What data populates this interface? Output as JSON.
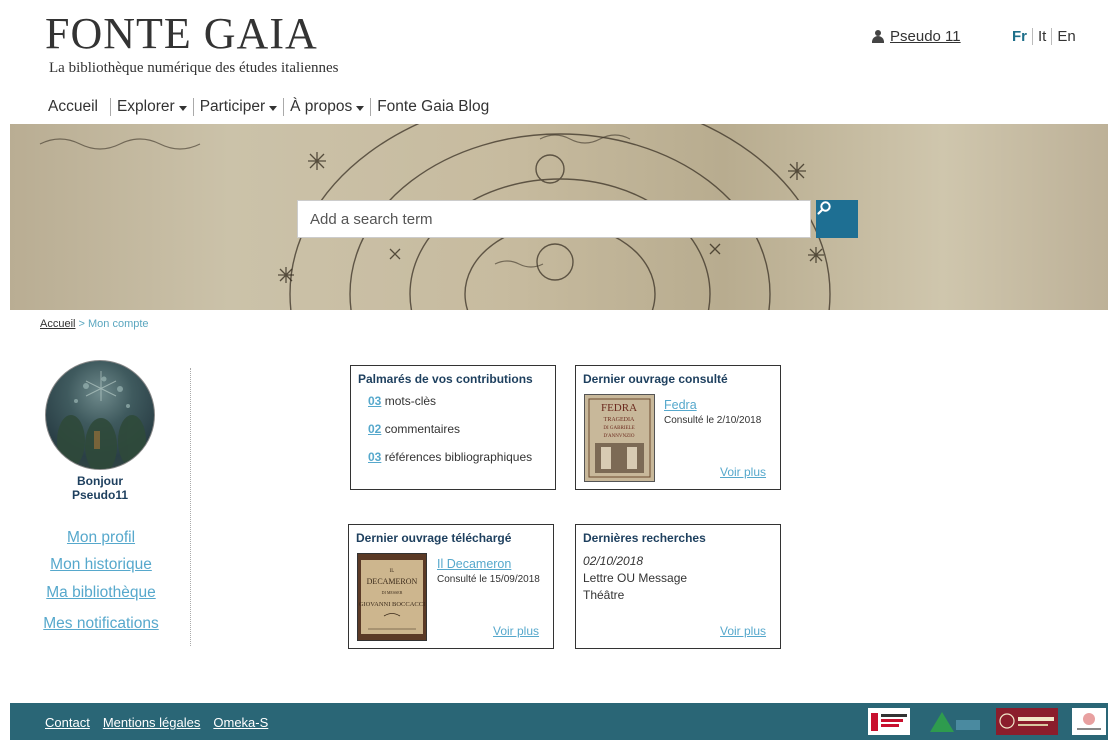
{
  "header": {
    "logo_title": "FONTE GAIA",
    "logo_subtitle": "La bibliothèque numérique des études italiennes",
    "user_name": "Pseudo 11",
    "languages": [
      "Fr",
      "It",
      "En"
    ]
  },
  "nav": {
    "items": [
      {
        "label": "Accueil",
        "dropdown": false
      },
      {
        "label": "Explorer",
        "dropdown": true
      },
      {
        "label": "Participer",
        "dropdown": true
      },
      {
        "label": "À propos",
        "dropdown": true
      },
      {
        "label": "Fonte Gaia Blog",
        "dropdown": false
      }
    ]
  },
  "search": {
    "placeholder": "Add a search term"
  },
  "breadcrumb": {
    "home": "Accueil",
    "separator": " > ",
    "current": "Mon compte"
  },
  "sidebar": {
    "greeting_line1": "Bonjour",
    "greeting_line2": "Pseudo11",
    "links": [
      "Mon profil",
      "Mon historique",
      "Ma bibliothèque",
      "Mes notifications"
    ]
  },
  "contributions": {
    "title": "Palmarés de vos contributions",
    "items": [
      {
        "count": "03",
        "label": "mots-clès"
      },
      {
        "count": "02",
        "label": "commentaires"
      },
      {
        "count": "03",
        "label": "références bibliographiques"
      }
    ]
  },
  "last_viewed": {
    "title": "Dernier ouvrage consulté",
    "book_title": "Fedra",
    "meta": "Consulté le 2/10/2018",
    "more": "Voir plus"
  },
  "last_downloaded": {
    "title": "Dernier ouvrage téléchargé",
    "book_title": "Il Decameron",
    "meta": "Consulté le 15/09/2018",
    "more": "Voir plus"
  },
  "last_searches": {
    "title": "Dernières recherches",
    "date": "02/10/2018",
    "queries": [
      "Lettre OU Message",
      "Théâtre"
    ],
    "more": "Voir plus"
  },
  "footer": {
    "links": [
      "Contact",
      "Mentions légales",
      "Omeka-S"
    ]
  },
  "colors": {
    "accent": "#1e6f93",
    "link": "#56a8cc",
    "footer": "#2a6676",
    "heading": "#1d3f5e"
  }
}
